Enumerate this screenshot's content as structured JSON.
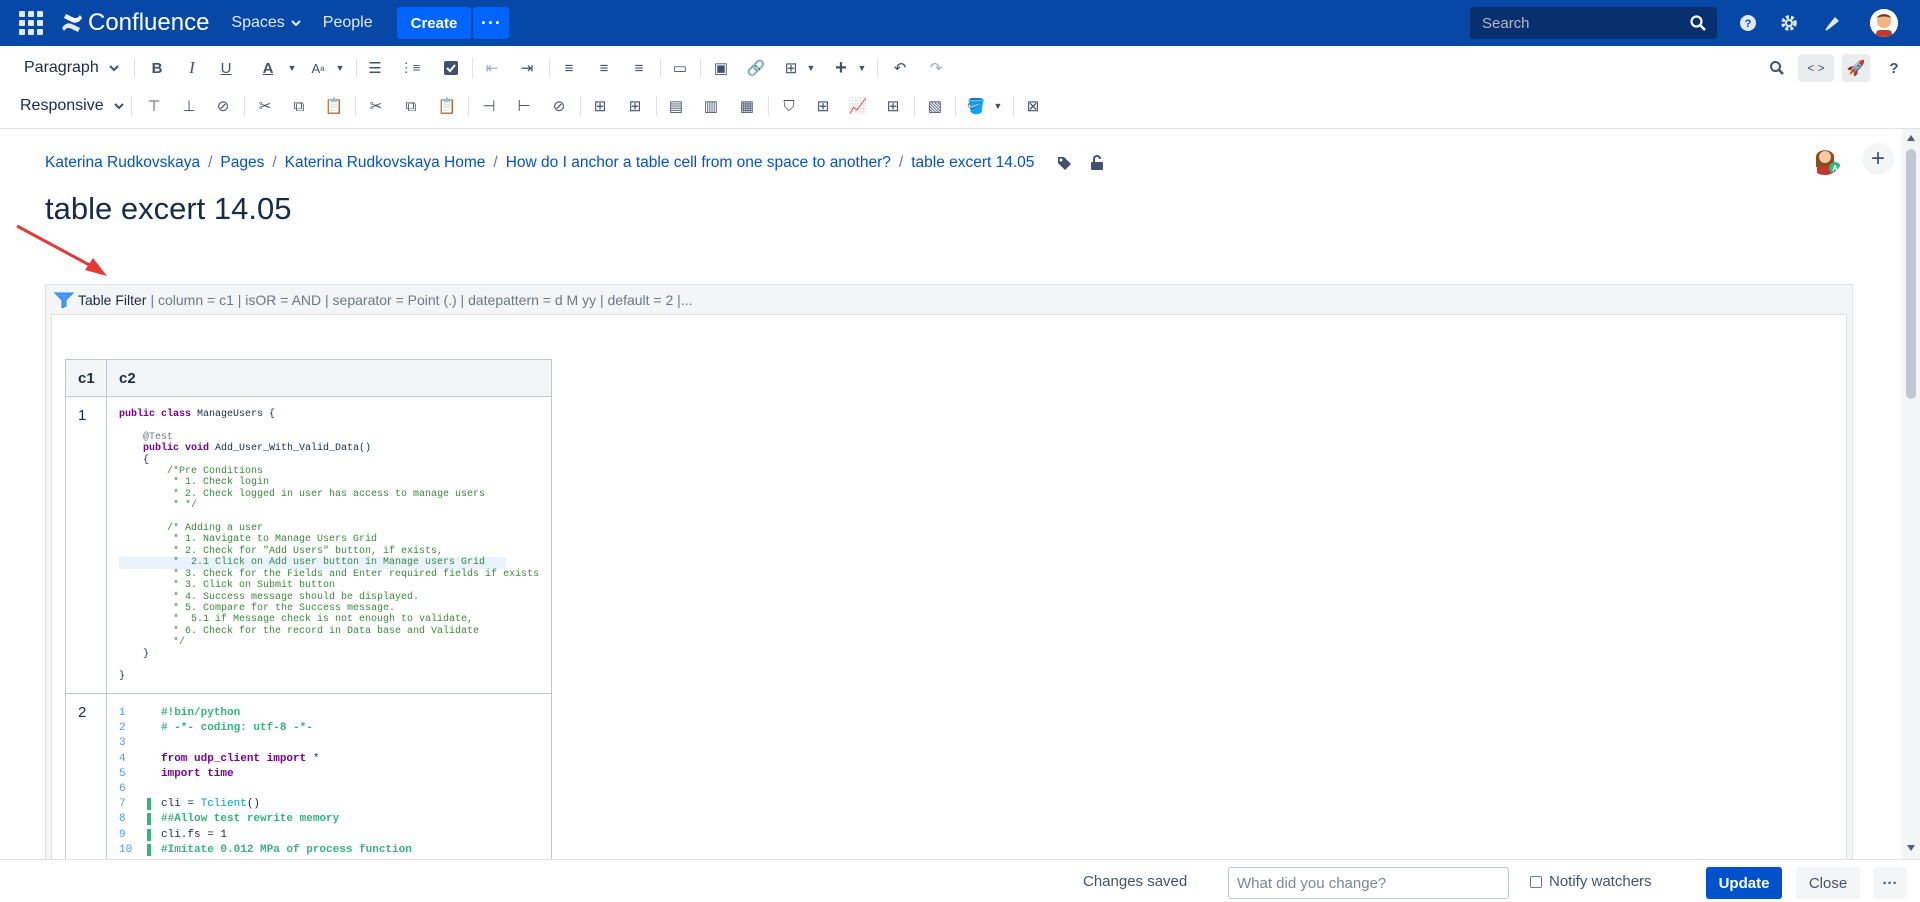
{
  "topnav": {
    "app_name": "Confluence",
    "spaces_label": "Spaces",
    "people_label": "People",
    "create_label": "Create",
    "more_label": "···",
    "search_placeholder": "Search"
  },
  "toolbar": {
    "paragraph_label": "Paragraph",
    "responsive_label": "Responsive",
    "source_label": "< >"
  },
  "breadcrumb": [
    "Katerina Rudkovskaya",
    "Pages",
    "Katerina Rudkovskaya Home",
    "How do I anchor a table cell from one space to another?",
    "table excert 14.05"
  ],
  "page": {
    "title": "table excert 14.05"
  },
  "macro": {
    "name": "Table Filter",
    "params": "| column = c1 | isOR = AND | separator = Point (.) | datepattern = d M yy | default = 2 |..."
  },
  "table": {
    "headers": [
      "c1",
      "c2"
    ],
    "row1_c1": "1",
    "row2_c1": "2"
  },
  "java_code": {
    "l1a": "public class",
    "l1b": " ManageUsers {",
    "l2": "    @Test",
    "l3a": "    public void",
    "l3b": " Add_User_With_Valid_Data()",
    "l4": "    {",
    "c1": "        /*Pre Conditions",
    "c2": "         * 1. Check login",
    "c3": "         * 2. Check logged in user has access to manage users",
    "c4": "         * */",
    "c5": "        /* Adding a user",
    "c6": "         * 1. Navigate to Manage Users Grid",
    "c7": "         * 2. Check for \"Add Users\" button, if exists,",
    "c8": "         *  2.1 Click on Add user button in Manage users Grid",
    "c9": "         * 3. Check for the Fields and Enter required fields if exists",
    "c10": "         * 3. Click on Submit button",
    "c11": "         * 4. Success message should be displayed.",
    "c12": "         * 5. Compare for the Success message.",
    "c13": "         *  5.1 if Message check is not enough to validate,",
    "c14": "         * 6. Check for the record in Data base and Validate",
    "c15": "         */",
    "l5": "    }",
    "l6": "}"
  },
  "python_code": {
    "n1": "1",
    "p1": "#!bin/python",
    "n2": "2",
    "p2": "# -*- coding: utf-8 -*-",
    "n3": "3",
    "n4": "4",
    "p4a": "from",
    "p4b": " udp_client ",
    "p4c": "import",
    "p4d": " *",
    "n5": "5",
    "p5": "import time",
    "n6": "6",
    "n7": "7",
    "p7a": "cli = ",
    "p7b": "Tclient",
    "p7c": "()",
    "n8": "8",
    "p8": "##Allow test rewrite memory",
    "n9": "9",
    "p9": "cli.fs = 1",
    "n10": "10",
    "p10": "#Imitate 0.012 MPa of process function"
  },
  "footer": {
    "status": "Changes saved",
    "change_placeholder": "What did you change?",
    "notify_label": "Notify watchers",
    "update_label": "Update",
    "close_label": "Close",
    "more_label": "···"
  },
  "colors": {
    "nav_bg": "#0747a6",
    "brand_blue": "#0052cc",
    "create_blue": "#0065ff"
  }
}
